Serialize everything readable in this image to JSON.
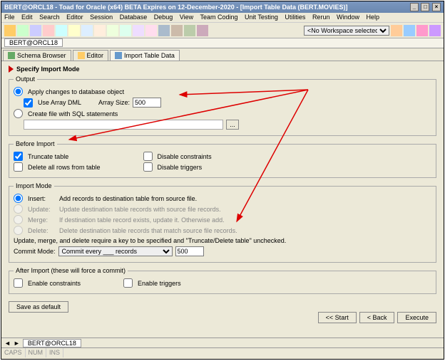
{
  "title": "BERT@ORCL18 - Toad for Oracle (x64)  BETA Expires on 12-December-2020 - [Import Table Data (BERT.MOVIES)]",
  "menu": [
    "File",
    "Edit",
    "Search",
    "Editor",
    "Session",
    "Database",
    "Debug",
    "View",
    "Team Coding",
    "Unit Testing",
    "Utilities",
    "Rerun",
    "Window",
    "Help"
  ],
  "workspace_placeholder": "<No Workspace selected>",
  "conn_tab": "BERT@ORCL18",
  "tabs": [
    {
      "label": "Schema Browser"
    },
    {
      "label": "Editor"
    },
    {
      "label": "Import Table Data"
    }
  ],
  "section_title": "Specify Import Mode",
  "output": {
    "legend": "Output",
    "apply": "Apply changes to database object",
    "use_array": "Use Array DML",
    "array_size_lbl": "Array Size:",
    "array_size_val": "500",
    "create_file": "Create file with SQL statements"
  },
  "before": {
    "legend": "Before Import",
    "truncate": "Truncate table",
    "delete_all": "Delete all rows from table",
    "dis_cons": "Disable constraints",
    "dis_trig": "Disable triggers"
  },
  "mode": {
    "legend": "Import Mode",
    "insert": {
      "lbl": "Insert:",
      "desc": "Add records to destination table from source file."
    },
    "update": {
      "lbl": "Update:",
      "desc": "Update destination table records with source file records."
    },
    "merge": {
      "lbl": "Merge:",
      "desc": "If destination table record exists, update it. Otherwise add."
    },
    "delete": {
      "lbl": "Delete:",
      "desc": "Delete destination table records that match source file records."
    },
    "note": "Update, merge, and delete require a key to be specified and \"Truncate/Delete table\" unchecked.",
    "commit_lbl": "Commit Mode:",
    "commit_sel": "Commit every ___ records",
    "commit_val": "500"
  },
  "after": {
    "legend": "After Import (these will force a commit)",
    "en_cons": "Enable constraints",
    "en_trig": "Enable triggers"
  },
  "save_default": "Save as default",
  "btns": {
    "start": "<< Start",
    "back": "< Back",
    "exec": "Execute"
  },
  "bottom_tab": "BERT@ORCL18",
  "status": [
    "CAPS",
    "NUM",
    "INS"
  ]
}
